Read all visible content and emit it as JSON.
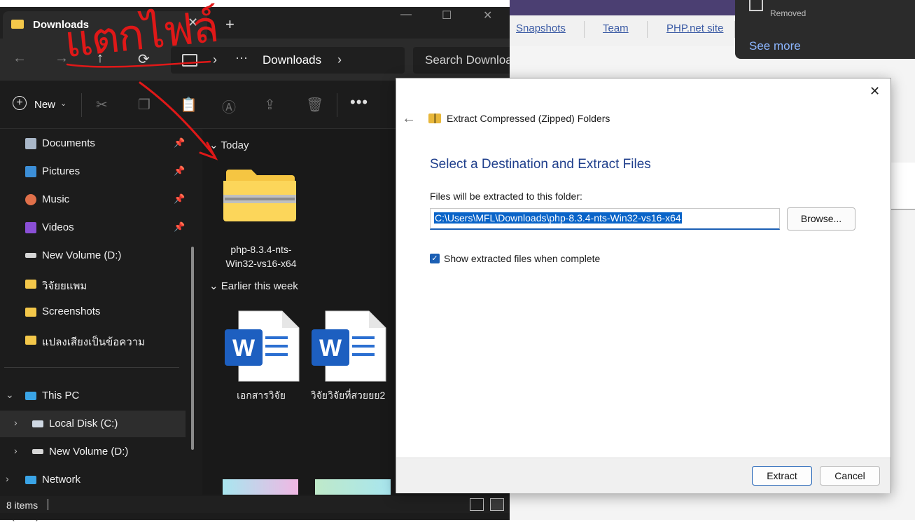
{
  "background": {
    "links": [
      "Snapshots",
      "Team",
      "PHP.net site"
    ],
    "bottom_text": "le (NTS) versions",
    "toast": {
      "status": "Removed",
      "see_more": "See more"
    }
  },
  "explorer": {
    "tab": {
      "title": "Downloads",
      "close": "✕",
      "new_tab": "+"
    },
    "window_controls": {
      "minimize": "—",
      "maximize": "☐",
      "close": "✕"
    },
    "nav": {
      "back": "←",
      "forward": "→",
      "up": "↑",
      "refresh": "⟳"
    },
    "address": {
      "more": "···",
      "current": "Downloads",
      "chevron": "›"
    },
    "search": {
      "placeholder": "Search Downloads"
    },
    "toolbar": {
      "new_label": "New",
      "new_chevron": "⌄",
      "more": "•••"
    },
    "sidebar": {
      "pinned": [
        {
          "label": "Documents",
          "icon": "documents-icon",
          "pin": "📌"
        },
        {
          "label": "Pictures",
          "icon": "pictures-icon",
          "pin": "📌"
        },
        {
          "label": "Music",
          "icon": "music-icon",
          "pin": "📌"
        },
        {
          "label": "Videos",
          "icon": "videos-icon",
          "pin": "📌"
        }
      ],
      "quick": [
        {
          "label": "New Volume (D:)",
          "icon": "drive-icon"
        },
        {
          "label": "วิจัยยแพม",
          "icon": "folder-icon"
        },
        {
          "label": "Screenshots",
          "icon": "folder-icon"
        },
        {
          "label": "แปลงเสียงเป็นข้อความ",
          "icon": "folder-icon"
        }
      ],
      "tree": [
        {
          "label": "This PC",
          "chevron": "⌄"
        },
        {
          "label": "Local Disk (C:)",
          "chevron": "›"
        },
        {
          "label": "New Volume (D:)",
          "chevron": "›"
        },
        {
          "label": "Network",
          "chevron": "›"
        }
      ]
    },
    "content": {
      "groups": [
        {
          "header": "Today",
          "chevron": "⌄"
        },
        {
          "header": "Earlier this week",
          "chevron": "⌄"
        }
      ],
      "files_today": [
        {
          "name": "php-8.3.4-nts-Win32-vs16-x64",
          "type": "zip-folder"
        }
      ],
      "files_week": [
        {
          "name": "เอกสารวิจัย",
          "type": "word-doc"
        },
        {
          "name": "วิจัยวิจัยที่สวยยย2",
          "type": "word-doc"
        }
      ]
    },
    "status": {
      "count": "8 items"
    }
  },
  "dialog": {
    "title": "Extract Compressed (Zipped) Folders",
    "heading": "Select a Destination and Extract Files",
    "label": "Files will be extracted to this folder:",
    "path": "C:\\Users\\MFL\\Downloads\\php-8.3.4-nts-Win32-vs16-x64",
    "browse": "Browse...",
    "checkbox": {
      "checked": true,
      "label": "Show extracted files when complete"
    },
    "extract": "Extract",
    "cancel": "Cancel",
    "close": "✕",
    "back": "←"
  },
  "annotation": {
    "text": "แตกไฟล์",
    "color": "#e01818"
  }
}
